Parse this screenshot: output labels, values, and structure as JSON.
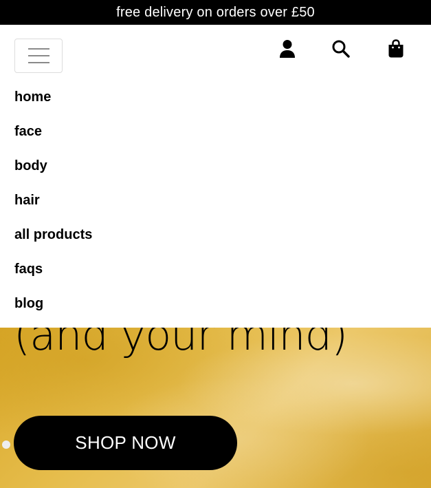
{
  "announcement": {
    "text": "free delivery on orders over £50"
  },
  "header": {
    "menu_icon": "hamburger-menu-icon",
    "account_icon": "account-icon",
    "search_icon": "search-icon",
    "bag_icon": "shopping-bag-icon"
  },
  "nav": {
    "items": [
      {
        "label": "home"
      },
      {
        "label": "face"
      },
      {
        "label": "body"
      },
      {
        "label": "hair"
      },
      {
        "label": "all products"
      },
      {
        "label": "faqs"
      },
      {
        "label": "blog"
      }
    ]
  },
  "hero": {
    "heading": "(and your mind)",
    "cta_label": "SHOP NOW"
  },
  "colors": {
    "black": "#000000",
    "white": "#ffffff",
    "hero_yellow": "#e2b544",
    "menu_border": "#dcdcdc"
  }
}
